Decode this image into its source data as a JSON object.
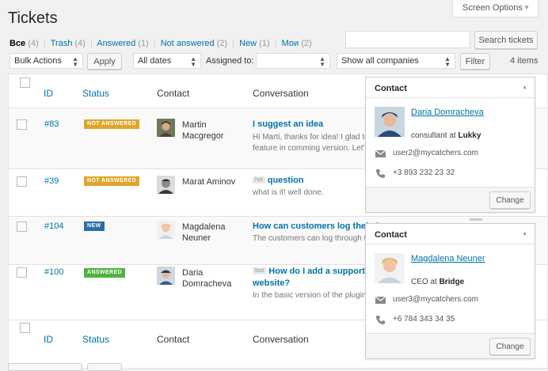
{
  "page": {
    "title": "Tickets",
    "screen_options": "Screen Options"
  },
  "views": [
    {
      "label": "Все",
      "count": "(4)"
    },
    {
      "label": "Trash",
      "count": "(4)"
    },
    {
      "label": "Answered",
      "count": "(1)"
    },
    {
      "label": "Not answered",
      "count": "(2)"
    },
    {
      "label": "New",
      "count": "(1)"
    },
    {
      "label": "Мои",
      "count": "(2)"
    }
  ],
  "search": {
    "button": "Search tickets",
    "value": ""
  },
  "filters": {
    "bulk_actions": "Bulk Actions",
    "apply": "Apply",
    "dates": "All dates",
    "assigned_label": "Assigned to:",
    "assigned_value": "",
    "companies": "Show all companies",
    "filter_button": "Filter",
    "items_count": "4 items"
  },
  "columns": {
    "id": "ID",
    "status": "Status",
    "contact": "Contact",
    "conversation": "Conversation"
  },
  "tickets": [
    {
      "id": "#83",
      "status": "NOT ANSWERED",
      "contact_line1": "Martin",
      "contact_line2": "Macgregor",
      "title": "I suggest an idea",
      "tag": "",
      "title_line2": "",
      "excerpt1": "Hi Marti, thanks for idea! I glad to",
      "excerpt2": "feature in comming version. Let's"
    },
    {
      "id": "#39",
      "status": "NOT ANSWERED",
      "contact_line1": "Marat Aminov",
      "contact_line2": "",
      "title": "question",
      "tag": "hot",
      "title_line2": "",
      "excerpt1": "what is it!  well done.",
      "excerpt2": ""
    },
    {
      "id": "#104",
      "status": "NEW",
      "contact_line1": "Magdalena",
      "contact_line2": "Neuner",
      "title": "How can customers log their C",
      "tag": "",
      "title_line2": "",
      "excerpt1": "The customers can log through th",
      "excerpt2": ""
    },
    {
      "id": "#100",
      "status": "ANSWERED",
      "contact_line1": "Daria",
      "contact_line2": "Domracheva",
      "title": "How do I add a support c",
      "tag": "fast",
      "title_line2": "website?",
      "excerpt1": "In the basic version of the plugin,",
      "excerpt2": ""
    }
  ],
  "contact_panels": [
    {
      "heading": "Contact",
      "name": "Daria Domracheva",
      "position": "consultant",
      "at": "at",
      "company": "Lukky",
      "email": "user2@mycatchers.com",
      "phone": "+3 893 232 23 32",
      "change": "Change"
    },
    {
      "heading": "Contact",
      "name": "Magdalena Neuner",
      "position": "CEO",
      "at": "at",
      "company": "Bridge",
      "email": "user3@mycatchers.com",
      "phone": "+6 784 343 34 35",
      "change": "Change"
    }
  ],
  "colors": {
    "accent": "#0073aa",
    "not_answered": "#e0a52a",
    "new": "#2a6fa8",
    "answered": "#4fb33f"
  }
}
